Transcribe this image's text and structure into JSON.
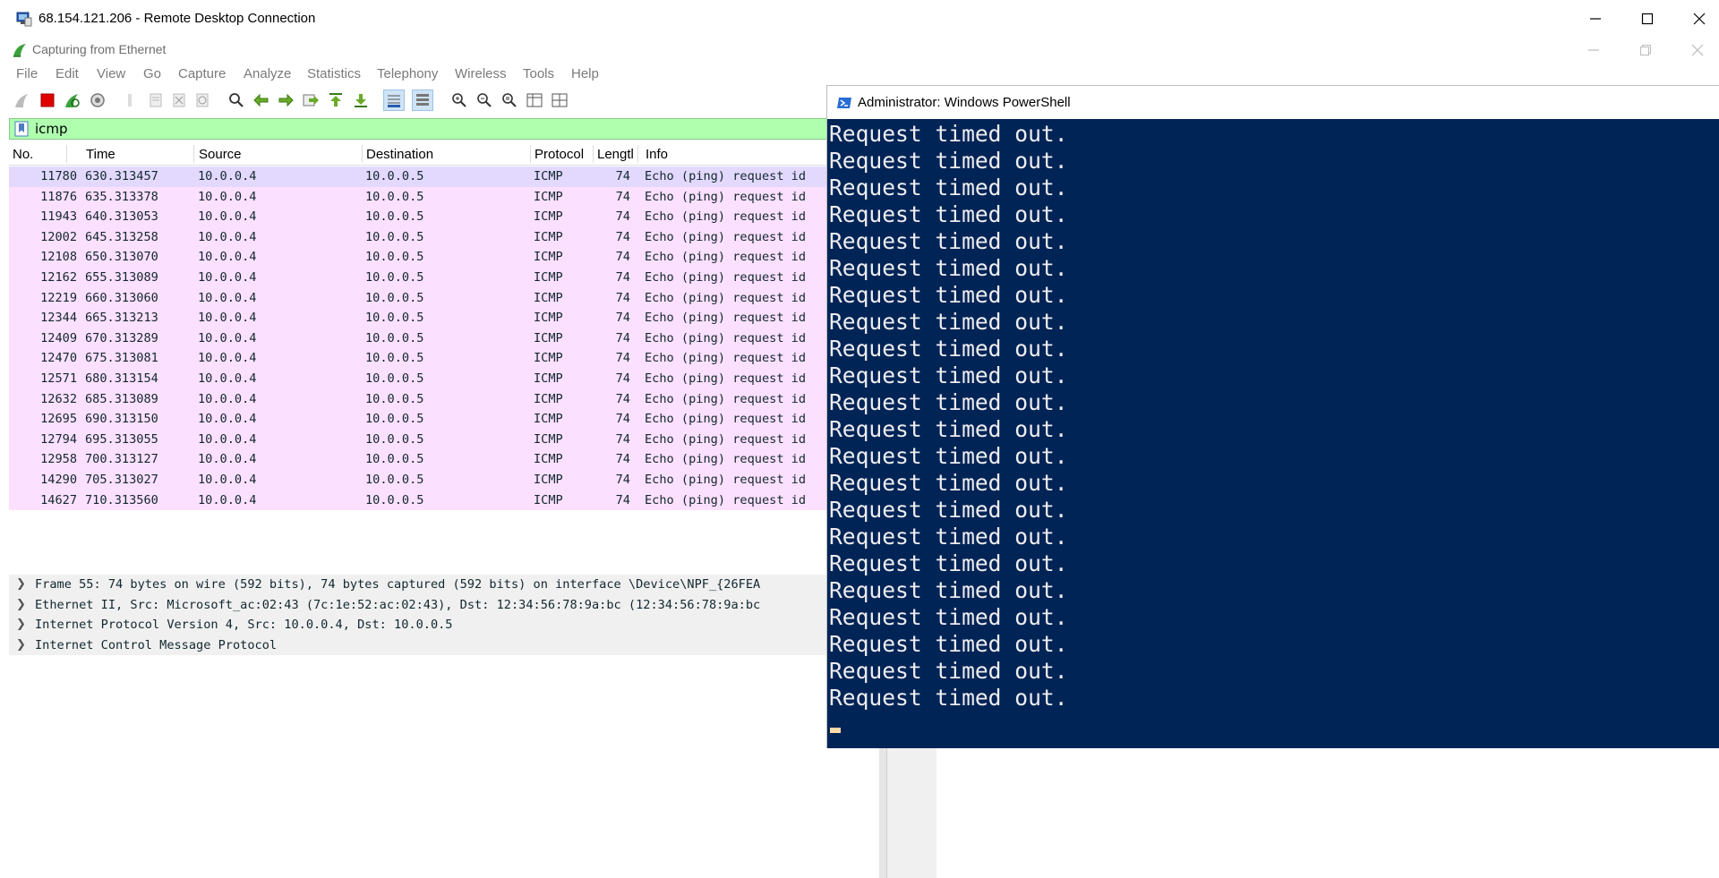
{
  "rdp": {
    "title": "68.154.121.206 - Remote Desktop Connection"
  },
  "wireshark": {
    "title": "Capturing from Ethernet",
    "menu": [
      "File",
      "Edit",
      "View",
      "Go",
      "Capture",
      "Analyze",
      "Statistics",
      "Telephony",
      "Wireless",
      "Tools",
      "Help"
    ],
    "toolbar_icons": [
      "shark-fin-start-icon",
      "stop-capture-icon",
      "restart-capture-icon",
      "capture-options-icon",
      "open-file-icon",
      "save-file-icon",
      "close-file-icon",
      "reload-file-icon",
      "find-packet-icon",
      "go-back-icon",
      "go-forward-icon",
      "go-to-packet-icon",
      "go-first-packet-icon",
      "go-last-packet-icon",
      "auto-scroll-icon",
      "colorize-icon",
      "zoom-in-icon",
      "zoom-out-icon",
      "normal-size-icon",
      "resize-columns-icon",
      "layout-icon"
    ],
    "filter": {
      "value": "icmp"
    },
    "columns": [
      "No.",
      "Time",
      "Source",
      "Destination",
      "Protocol",
      "Lengtl",
      "Info"
    ],
    "packets": [
      {
        "no": "11780",
        "time": "630.313457",
        "src": "10.0.0.4",
        "dst": "10.0.0.5",
        "proto": "ICMP",
        "len": "74",
        "info": "Echo (ping) request  id"
      },
      {
        "no": "11876",
        "time": "635.313378",
        "src": "10.0.0.4",
        "dst": "10.0.0.5",
        "proto": "ICMP",
        "len": "74",
        "info": "Echo (ping) request  id"
      },
      {
        "no": "11943",
        "time": "640.313053",
        "src": "10.0.0.4",
        "dst": "10.0.0.5",
        "proto": "ICMP",
        "len": "74",
        "info": "Echo (ping) request  id"
      },
      {
        "no": "12002",
        "time": "645.313258",
        "src": "10.0.0.4",
        "dst": "10.0.0.5",
        "proto": "ICMP",
        "len": "74",
        "info": "Echo (ping) request  id"
      },
      {
        "no": "12108",
        "time": "650.313070",
        "src": "10.0.0.4",
        "dst": "10.0.0.5",
        "proto": "ICMP",
        "len": "74",
        "info": "Echo (ping) request  id"
      },
      {
        "no": "12162",
        "time": "655.313089",
        "src": "10.0.0.4",
        "dst": "10.0.0.5",
        "proto": "ICMP",
        "len": "74",
        "info": "Echo (ping) request  id"
      },
      {
        "no": "12219",
        "time": "660.313060",
        "src": "10.0.0.4",
        "dst": "10.0.0.5",
        "proto": "ICMP",
        "len": "74",
        "info": "Echo (ping) request  id"
      },
      {
        "no": "12344",
        "time": "665.313213",
        "src": "10.0.0.4",
        "dst": "10.0.0.5",
        "proto": "ICMP",
        "len": "74",
        "info": "Echo (ping) request  id"
      },
      {
        "no": "12409",
        "time": "670.313289",
        "src": "10.0.0.4",
        "dst": "10.0.0.5",
        "proto": "ICMP",
        "len": "74",
        "info": "Echo (ping) request  id"
      },
      {
        "no": "12470",
        "time": "675.313081",
        "src": "10.0.0.4",
        "dst": "10.0.0.5",
        "proto": "ICMP",
        "len": "74",
        "info": "Echo (ping) request  id"
      },
      {
        "no": "12571",
        "time": "680.313154",
        "src": "10.0.0.4",
        "dst": "10.0.0.5",
        "proto": "ICMP",
        "len": "74",
        "info": "Echo (ping) request  id"
      },
      {
        "no": "12632",
        "time": "685.313089",
        "src": "10.0.0.4",
        "dst": "10.0.0.5",
        "proto": "ICMP",
        "len": "74",
        "info": "Echo (ping) request  id"
      },
      {
        "no": "12695",
        "time": "690.313150",
        "src": "10.0.0.4",
        "dst": "10.0.0.5",
        "proto": "ICMP",
        "len": "74",
        "info": "Echo (ping) request  id"
      },
      {
        "no": "12794",
        "time": "695.313055",
        "src": "10.0.0.4",
        "dst": "10.0.0.5",
        "proto": "ICMP",
        "len": "74",
        "info": "Echo (ping) request  id"
      },
      {
        "no": "12958",
        "time": "700.313127",
        "src": "10.0.0.4",
        "dst": "10.0.0.5",
        "proto": "ICMP",
        "len": "74",
        "info": "Echo (ping) request  id"
      },
      {
        "no": "14290",
        "time": "705.313027",
        "src": "10.0.0.4",
        "dst": "10.0.0.5",
        "proto": "ICMP",
        "len": "74",
        "info": "Echo (ping) request  id"
      },
      {
        "no": "14627",
        "time": "710.313560",
        "src": "10.0.0.4",
        "dst": "10.0.0.5",
        "proto": "ICMP",
        "len": "74",
        "info": "Echo (ping) request  id"
      }
    ],
    "details": [
      "Frame 55: 74 bytes on wire (592 bits), 74 bytes captured (592 bits) on interface \\Device\\NPF_{26FEA",
      "Ethernet II, Src: Microsoft_ac:02:43 (7c:1e:52:ac:02:43), Dst: 12:34:56:78:9a:bc (12:34:56:78:9a:bc",
      "Internet Protocol Version 4, Src: 10.0.0.4, Dst: 10.0.0.5",
      "Internet Control Message Protocol"
    ]
  },
  "powershell": {
    "title": "Administrator: Windows PowerShell",
    "lines": [
      "Request timed out.",
      "Request timed out.",
      "Request timed out.",
      "Request timed out.",
      "Request timed out.",
      "Request timed out.",
      "Request timed out.",
      "Request timed out.",
      "Request timed out.",
      "Request timed out.",
      "Request timed out.",
      "Request timed out.",
      "Request timed out.",
      "Request timed out.",
      "Request timed out.",
      "Request timed out.",
      "Request timed out.",
      "Request timed out.",
      "Request timed out.",
      "Request timed out.",
      "Request timed out.",
      "Request timed out."
    ]
  },
  "colors": {
    "packet_row": "#fce0ff",
    "selected_row": "#e3d9ff",
    "filter_bg": "#afffaf",
    "powershell_bg": "#012456",
    "powershell_text": "#eeedf0"
  }
}
